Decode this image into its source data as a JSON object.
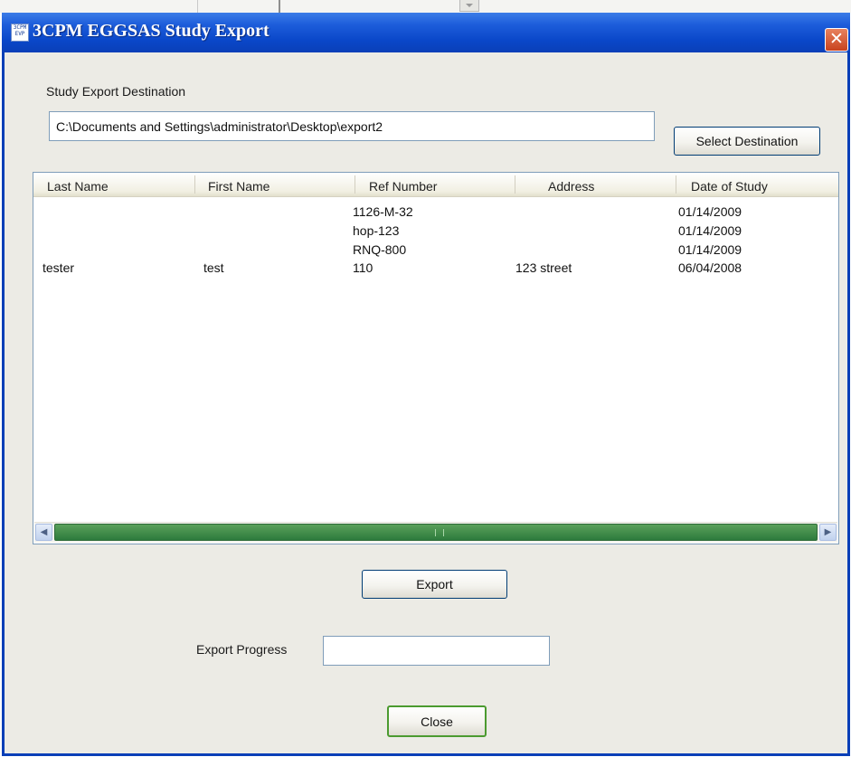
{
  "window": {
    "icon_text": "3CPM EVP",
    "title": "3CPM EGGSAS Study Export",
    "close_glyph": "✕"
  },
  "destination": {
    "label": "Study Export Destination",
    "value": "C:\\Documents and Settings\\administrator\\Desktop\\export2",
    "select_button": "Select Destination"
  },
  "table": {
    "columns": [
      "Last Name",
      "First Name",
      "Ref Number",
      "Address",
      "Date of Study"
    ],
    "rows": [
      [
        "",
        "",
        "1126-M-32",
        "",
        "01/14/2009"
      ],
      [
        "",
        "",
        "hop-123",
        "",
        "01/14/2009"
      ],
      [
        "",
        "",
        "RNQ-800",
        "",
        "01/14/2009"
      ],
      [
        "tester",
        "test",
        "110",
        "123 street",
        "06/04/2008"
      ]
    ],
    "scrollbar": {
      "left_arrow": "◀",
      "right_arrow": "▶"
    }
  },
  "actions": {
    "export_button": "Export",
    "progress_label": "Export Progress",
    "progress_value": "",
    "close_button": "Close"
  }
}
